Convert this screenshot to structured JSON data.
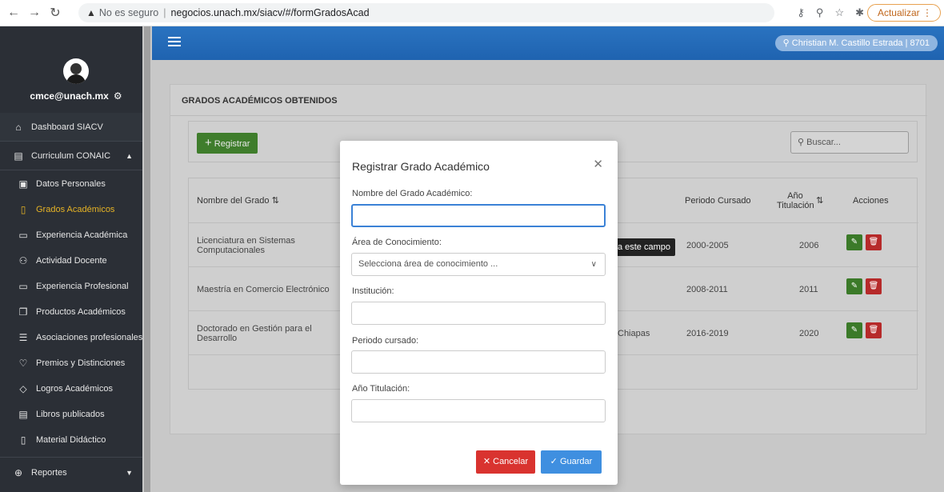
{
  "browser": {
    "security_label": "No es seguro",
    "url": "negocios.unach.mx/siacv/#/formGradosAcad",
    "update_label": "Actualizar"
  },
  "sidebar": {
    "email": "cmce@unach.mx",
    "dashboard": "Dashboard SIACV",
    "group": "Curriculum CONAIC",
    "items": [
      {
        "label": "Datos Personales",
        "icon": "id-card-icon"
      },
      {
        "label": "Grados Académicos",
        "icon": "bookmark-icon"
      },
      {
        "label": "Experiencia Académica",
        "icon": "briefcase-icon"
      },
      {
        "label": "Actividad Docente",
        "icon": "users-icon"
      },
      {
        "label": "Experiencia Profesional",
        "icon": "window-icon"
      },
      {
        "label": "Productos Académicos",
        "icon": "copy-icon"
      },
      {
        "label": "Asociaciones profesionales",
        "icon": "list-icon"
      },
      {
        "label": "Premios y Distinciones",
        "icon": "shield-icon"
      },
      {
        "label": "Logros Académicos",
        "icon": "tag-icon"
      },
      {
        "label": "Libros publicados",
        "icon": "book-icon"
      },
      {
        "label": "Material Didáctico",
        "icon": "file-icon"
      }
    ],
    "reports": "Reportes"
  },
  "header": {
    "user": "Christian M. Castillo Estrada | 8701"
  },
  "card": {
    "title": "GRADOS ACADÉMICOS OBTENIDOS",
    "register_label": "Registrar",
    "search_placeholder": "Buscar...",
    "columns": {
      "name": "Nombre del Grado",
      "period": "Periodo Cursado",
      "year": "Año Titulación",
      "actions": "Acciones"
    },
    "rows": [
      {
        "name": "Licenciatura en Sistemas Computacionales",
        "institution": "",
        "period": "2000-2005",
        "year": "2006"
      },
      {
        "name": "Maestría en Comercio Electrónico",
        "institution": "",
        "period": "2008-2011",
        "year": "2011"
      },
      {
        "name": "Doctorado en Gestión para el Desarrollo",
        "institution": "Chiapas",
        "period": "2016-2019",
        "year": "2020"
      }
    ]
  },
  "modal": {
    "title": "Registrar Grado Académico",
    "name_label": "Nombre del Grado Académico:",
    "area_label": "Área de Conocimiento:",
    "area_placeholder": "Selecciona área de conocimiento ...",
    "institution_label": "Institución:",
    "period_label": "Periodo cursado:",
    "year_label": "Año Titulación:",
    "cancel_label": "Cancelar",
    "save_label": "Guardar",
    "tooltip": "Completa este campo"
  }
}
